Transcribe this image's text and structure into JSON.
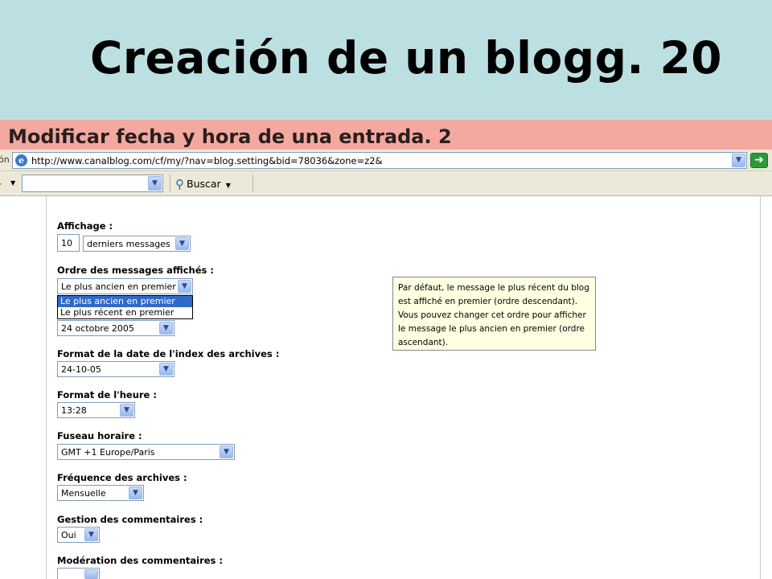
{
  "slide": {
    "title": "Creación de un blogg. 20",
    "subtitle": "Modificar fecha y hora de una entrada. 2"
  },
  "browser": {
    "address_label": "ón",
    "url": "http://www.canalblog.com/cf/my/?nav=blog.setting&bid=78036&zone=z2&",
    "search_value": "",
    "search_button_label": "Buscar",
    "icons": [
      "ie-page-icon",
      "dropdown-arrow-icon",
      "go-arrow-icon",
      "magnifier-icon"
    ]
  },
  "form": {
    "affichage": {
      "label": "Affichage :",
      "count": "10",
      "selected": "derniers messages"
    },
    "ordre": {
      "label": "Ordre des messages affichés :",
      "selected": "Le plus ancien en premier",
      "options": [
        "Le plus ancien en premier",
        "Le plus récent en premier"
      ],
      "highlighted_option": "Le plus ancien en premier"
    },
    "date_format": {
      "selected": "24 octobre 2005"
    },
    "archive_date_format": {
      "label": "Format de la date de l'index des archives :",
      "selected": "24-10-05"
    },
    "time_format": {
      "label": "Format de l'heure :",
      "selected": "13:28"
    },
    "timezone": {
      "label": "Fuseau horaire :",
      "selected": "GMT +1 Europe/Paris"
    },
    "archive_frequency": {
      "label": "Fréquence des archives :",
      "selected": "Mensuelle"
    },
    "comments": {
      "label": "Gestion des commentaires :",
      "selected": "Oui"
    },
    "moderation": {
      "label": "Modération des commentaires :"
    }
  },
  "tooltip": {
    "text": "Par défaut, le message le plus récent du blog est affiché en premier (ordre descendant). Vous pouvez changer cet ordre pour afficher le message le plus ancien en premier (ordre ascendant)."
  },
  "colors": {
    "title_band": "#bce0e1",
    "subtitle_band": "#f3a8a0",
    "toolbar": "#ece9d8",
    "selection": "#316ac5",
    "tooltip_bg": "#ffffe1"
  }
}
